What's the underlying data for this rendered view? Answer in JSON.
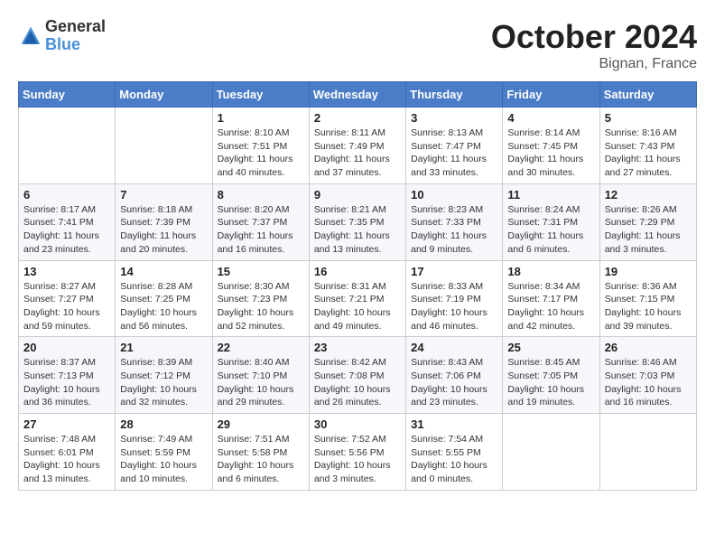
{
  "header": {
    "logo_general": "General",
    "logo_blue": "Blue",
    "month_title": "October 2024",
    "location": "Bignan, France"
  },
  "days_of_week": [
    "Sunday",
    "Monday",
    "Tuesday",
    "Wednesday",
    "Thursday",
    "Friday",
    "Saturday"
  ],
  "weeks": [
    [
      {
        "day": "",
        "info": ""
      },
      {
        "day": "",
        "info": ""
      },
      {
        "day": "1",
        "info": "Sunrise: 8:10 AM\nSunset: 7:51 PM\nDaylight: 11 hours and 40 minutes."
      },
      {
        "day": "2",
        "info": "Sunrise: 8:11 AM\nSunset: 7:49 PM\nDaylight: 11 hours and 37 minutes."
      },
      {
        "day": "3",
        "info": "Sunrise: 8:13 AM\nSunset: 7:47 PM\nDaylight: 11 hours and 33 minutes."
      },
      {
        "day": "4",
        "info": "Sunrise: 8:14 AM\nSunset: 7:45 PM\nDaylight: 11 hours and 30 minutes."
      },
      {
        "day": "5",
        "info": "Sunrise: 8:16 AM\nSunset: 7:43 PM\nDaylight: 11 hours and 27 minutes."
      }
    ],
    [
      {
        "day": "6",
        "info": "Sunrise: 8:17 AM\nSunset: 7:41 PM\nDaylight: 11 hours and 23 minutes."
      },
      {
        "day": "7",
        "info": "Sunrise: 8:18 AM\nSunset: 7:39 PM\nDaylight: 11 hours and 20 minutes."
      },
      {
        "day": "8",
        "info": "Sunrise: 8:20 AM\nSunset: 7:37 PM\nDaylight: 11 hours and 16 minutes."
      },
      {
        "day": "9",
        "info": "Sunrise: 8:21 AM\nSunset: 7:35 PM\nDaylight: 11 hours and 13 minutes."
      },
      {
        "day": "10",
        "info": "Sunrise: 8:23 AM\nSunset: 7:33 PM\nDaylight: 11 hours and 9 minutes."
      },
      {
        "day": "11",
        "info": "Sunrise: 8:24 AM\nSunset: 7:31 PM\nDaylight: 11 hours and 6 minutes."
      },
      {
        "day": "12",
        "info": "Sunrise: 8:26 AM\nSunset: 7:29 PM\nDaylight: 11 hours and 3 minutes."
      }
    ],
    [
      {
        "day": "13",
        "info": "Sunrise: 8:27 AM\nSunset: 7:27 PM\nDaylight: 10 hours and 59 minutes."
      },
      {
        "day": "14",
        "info": "Sunrise: 8:28 AM\nSunset: 7:25 PM\nDaylight: 10 hours and 56 minutes."
      },
      {
        "day": "15",
        "info": "Sunrise: 8:30 AM\nSunset: 7:23 PM\nDaylight: 10 hours and 52 minutes."
      },
      {
        "day": "16",
        "info": "Sunrise: 8:31 AM\nSunset: 7:21 PM\nDaylight: 10 hours and 49 minutes."
      },
      {
        "day": "17",
        "info": "Sunrise: 8:33 AM\nSunset: 7:19 PM\nDaylight: 10 hours and 46 minutes."
      },
      {
        "day": "18",
        "info": "Sunrise: 8:34 AM\nSunset: 7:17 PM\nDaylight: 10 hours and 42 minutes."
      },
      {
        "day": "19",
        "info": "Sunrise: 8:36 AM\nSunset: 7:15 PM\nDaylight: 10 hours and 39 minutes."
      }
    ],
    [
      {
        "day": "20",
        "info": "Sunrise: 8:37 AM\nSunset: 7:13 PM\nDaylight: 10 hours and 36 minutes."
      },
      {
        "day": "21",
        "info": "Sunrise: 8:39 AM\nSunset: 7:12 PM\nDaylight: 10 hours and 32 minutes."
      },
      {
        "day": "22",
        "info": "Sunrise: 8:40 AM\nSunset: 7:10 PM\nDaylight: 10 hours and 29 minutes."
      },
      {
        "day": "23",
        "info": "Sunrise: 8:42 AM\nSunset: 7:08 PM\nDaylight: 10 hours and 26 minutes."
      },
      {
        "day": "24",
        "info": "Sunrise: 8:43 AM\nSunset: 7:06 PM\nDaylight: 10 hours and 23 minutes."
      },
      {
        "day": "25",
        "info": "Sunrise: 8:45 AM\nSunset: 7:05 PM\nDaylight: 10 hours and 19 minutes."
      },
      {
        "day": "26",
        "info": "Sunrise: 8:46 AM\nSunset: 7:03 PM\nDaylight: 10 hours and 16 minutes."
      }
    ],
    [
      {
        "day": "27",
        "info": "Sunrise: 7:48 AM\nSunset: 6:01 PM\nDaylight: 10 hours and 13 minutes."
      },
      {
        "day": "28",
        "info": "Sunrise: 7:49 AM\nSunset: 5:59 PM\nDaylight: 10 hours and 10 minutes."
      },
      {
        "day": "29",
        "info": "Sunrise: 7:51 AM\nSunset: 5:58 PM\nDaylight: 10 hours and 6 minutes."
      },
      {
        "day": "30",
        "info": "Sunrise: 7:52 AM\nSunset: 5:56 PM\nDaylight: 10 hours and 3 minutes."
      },
      {
        "day": "31",
        "info": "Sunrise: 7:54 AM\nSunset: 5:55 PM\nDaylight: 10 hours and 0 minutes."
      },
      {
        "day": "",
        "info": ""
      },
      {
        "day": "",
        "info": ""
      }
    ]
  ]
}
